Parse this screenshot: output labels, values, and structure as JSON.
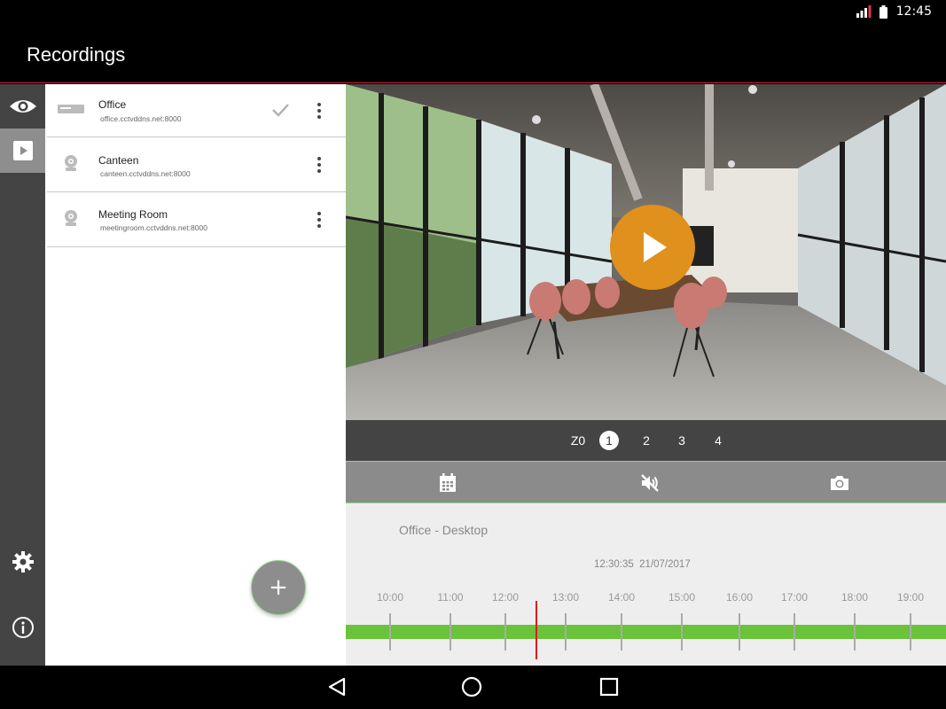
{
  "status_bar": {
    "time": "12:45"
  },
  "app_bar": {
    "title": "Recordings"
  },
  "devices": [
    {
      "name": "Office",
      "host": "office.cctvddns.net:8000",
      "selected": true
    },
    {
      "name": "Canteen",
      "host": "canteen.cctvddns.net:8000",
      "selected": false
    },
    {
      "name": "Meeting Room",
      "host": "meetingroom.cctvddns.net:8000",
      "selected": false
    }
  ],
  "fab": {
    "label": "+"
  },
  "channels": {
    "zoom_label": "Z0",
    "items": [
      "1",
      "2",
      "3",
      "4"
    ],
    "selected": "1"
  },
  "timeline": {
    "title": "Office - Desktop",
    "current_time": "12:30:35",
    "current_date": "21/07/2017",
    "hours": [
      "10:00",
      "11:00",
      "12:00",
      "13:00",
      "14:00",
      "15:00",
      "16:00",
      "17:00",
      "18:00",
      "19:00"
    ]
  },
  "colors": {
    "accent_red": "#d9233a",
    "play_orange": "#e0901d",
    "recording_green": "#6ac33b",
    "toolbar_border_green": "#8ed48e",
    "cursor_red": "#e8101a"
  }
}
